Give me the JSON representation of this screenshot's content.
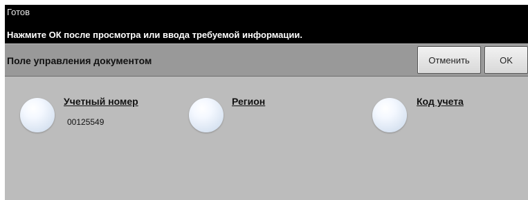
{
  "status": {
    "state": "Готов",
    "message": "Нажмите ОК после просмотра или ввода требуемой информации."
  },
  "header": {
    "title": "Поле управления документом",
    "cancel_label": "Отменить",
    "ok_label": "OK"
  },
  "fields": [
    {
      "label": "Учетный номер",
      "value": "00125549"
    },
    {
      "label": "Регион",
      "value": ""
    },
    {
      "label": "Код учета",
      "value": ""
    }
  ],
  "colors": {
    "status_bar": "#000000",
    "header_bar": "#999999",
    "content_bg": "#bcbcbc",
    "radio": "#d8e3f1"
  }
}
